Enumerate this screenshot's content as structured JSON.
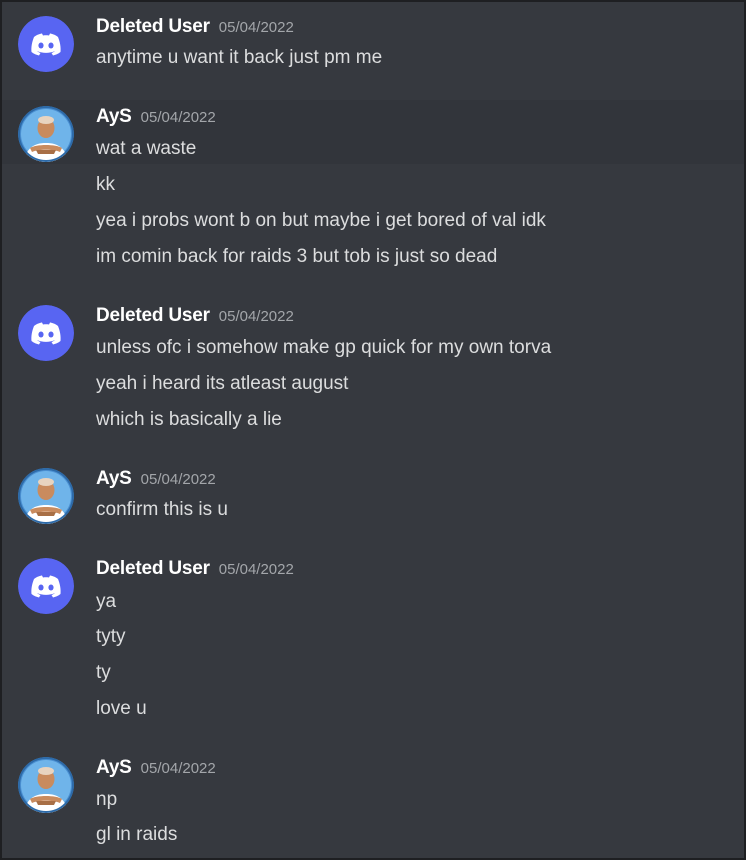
{
  "colors": {
    "background": "#36393f",
    "highlight_row": "#32353b",
    "username": "#ffffff",
    "message_text": "#dcddde",
    "timestamp": "#a3a6aa",
    "discord_blurple": "#5865f2"
  },
  "groups": [
    {
      "author": "Deleted User",
      "timestamp": "05/04/2022",
      "avatar_icon": "discord-logo-icon",
      "messages": [
        "anytime u want it back just pm me"
      ]
    },
    {
      "author": "AyS",
      "timestamp": "05/04/2022",
      "avatar_icon": "profile-photo",
      "messages": [
        "wat a waste",
        "kk",
        "yea i probs wont b on but maybe i get bored of val idk",
        "im comin back for raids 3 but tob is just so dead"
      ]
    },
    {
      "author": "Deleted User",
      "timestamp": "05/04/2022",
      "avatar_icon": "discord-logo-icon",
      "messages": [
        "unless ofc i somehow make gp quick for my own torva",
        "yeah i heard its atleast august",
        "which is basically a lie"
      ]
    },
    {
      "author": "AyS",
      "timestamp": "05/04/2022",
      "avatar_icon": "profile-photo",
      "messages": [
        "confirm this is u"
      ]
    },
    {
      "author": "Deleted User",
      "timestamp": "05/04/2022",
      "avatar_icon": "discord-logo-icon",
      "messages": [
        "ya",
        "tyty",
        "ty",
        "love u"
      ]
    },
    {
      "author": "AyS",
      "timestamp": "05/04/2022",
      "avatar_icon": "profile-photo",
      "messages": [
        "np",
        "gl in raids"
      ]
    }
  ]
}
